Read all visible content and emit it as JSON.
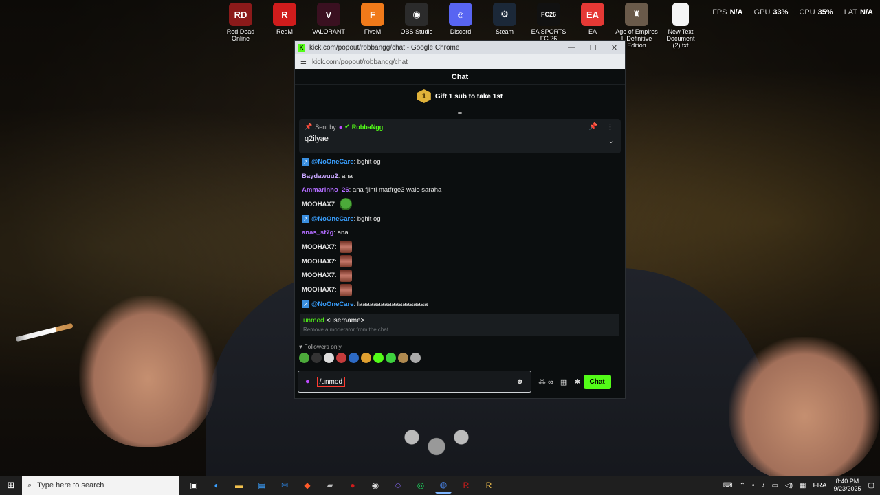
{
  "desktop": {
    "icons": [
      {
        "label": "Red Dead Online",
        "icon": "red-dead-online-icon",
        "color": "#8b1a1a",
        "glyph": "RD"
      },
      {
        "label": "RedM",
        "icon": "redm-icon",
        "color": "#d01c1c",
        "glyph": "R"
      },
      {
        "label": "VALORANT",
        "icon": "valorant-icon",
        "color": "#3a1020",
        "glyph": "V"
      },
      {
        "label": "FiveM",
        "icon": "fivem-icon",
        "color": "#f07a1a",
        "glyph": "F"
      },
      {
        "label": "OBS Studio",
        "icon": "obs-icon",
        "color": "#2b2b2b",
        "glyph": "◉"
      },
      {
        "label": "Discord",
        "icon": "discord-icon",
        "color": "#5865f2",
        "glyph": "☺"
      },
      {
        "label": "Steam",
        "icon": "steam-icon",
        "color": "#1b2838",
        "glyph": "⚙"
      },
      {
        "label": "EA SPORTS FC 26",
        "icon": "ea-fc26-icon",
        "color": "#111",
        "glyph": "FC26"
      },
      {
        "label": "EA",
        "icon": "ea-icon",
        "color": "#e53935",
        "glyph": "EA"
      },
      {
        "label": "Age of Empires II Definitive Edition",
        "icon": "aoe2-icon",
        "color": "#6a5a4a",
        "glyph": "♜"
      },
      {
        "label": "New Text Document (2).txt",
        "icon": "text-file-icon",
        "color": "#f5f5f5",
        "glyph": ""
      }
    ]
  },
  "overlay": {
    "fps_label": "FPS",
    "fps_value": "N/A",
    "gpu_label": "GPU",
    "gpu_value": "33%",
    "cpu_label": "CPU",
    "cpu_value": "35%",
    "lat_label": "LAT",
    "lat_value": "N/A"
  },
  "window": {
    "title": "kick.com/popout/robbangg/chat - Google Chrome",
    "url": "kick.com/popout/robbangg/chat",
    "favicon": "K",
    "minimize": "—",
    "maximize": "☐",
    "close": "✕"
  },
  "chat": {
    "header": "Chat",
    "gift_rank": "1",
    "gift_text": "Gift 1 sub to take 1st",
    "pinned": {
      "sent_by": "Sent by",
      "author": "RobbaNgg",
      "message": "q2ilyae"
    },
    "messages": [
      {
        "user": "@NoOneCare",
        "color": "#3aa0ff",
        "vip": true,
        "text": ": bghit og",
        "emote": ""
      },
      {
        "user": "Baydawuu2",
        "color": "#c9a7ff",
        "vip": false,
        "text": ": ana",
        "emote": ""
      },
      {
        "user": "Ammarinho_26",
        "color": "#b26cff",
        "vip": false,
        "text": ": ana fjihti matfrge3 walo saraha",
        "emote": ""
      },
      {
        "user": "MOOHAX7",
        "color": "#e6e6e6",
        "vip": false,
        "text": ":",
        "emote": "frog"
      },
      {
        "user": "@NoOneCare",
        "color": "#3aa0ff",
        "vip": true,
        "text": ": bghit og",
        "emote": ""
      },
      {
        "user": "anas_st7g",
        "color": "#b26cff",
        "vip": false,
        "text": ": ana",
        "emote": ""
      },
      {
        "user": "MOOHAX7",
        "color": "#e6e6e6",
        "vip": false,
        "text": ":",
        "emote": "face"
      },
      {
        "user": "MOOHAX7",
        "color": "#e6e6e6",
        "vip": false,
        "text": ":",
        "emote": "face"
      },
      {
        "user": "MOOHAX7",
        "color": "#e6e6e6",
        "vip": false,
        "text": ":",
        "emote": "face"
      },
      {
        "user": "MOOHAX7",
        "color": "#e6e6e6",
        "vip": false,
        "text": ":",
        "emote": "face"
      },
      {
        "user": "@NoOneCare",
        "color": "#3aa0ff",
        "vip": true,
        "text": ": laaaaaaaaaaaaaaaaaaa",
        "emote": ""
      }
    ],
    "suggestion": {
      "command": "unmod",
      "argument": " <username>",
      "description": "Remove a moderator from the chat"
    },
    "followers_only": "Followers only",
    "input_value": "/unmod",
    "send_label": "Chat"
  },
  "taskbar": {
    "search_placeholder": "Type here to search",
    "language": "FRA",
    "time": "8:40 PM",
    "date": "9/23/2025"
  }
}
